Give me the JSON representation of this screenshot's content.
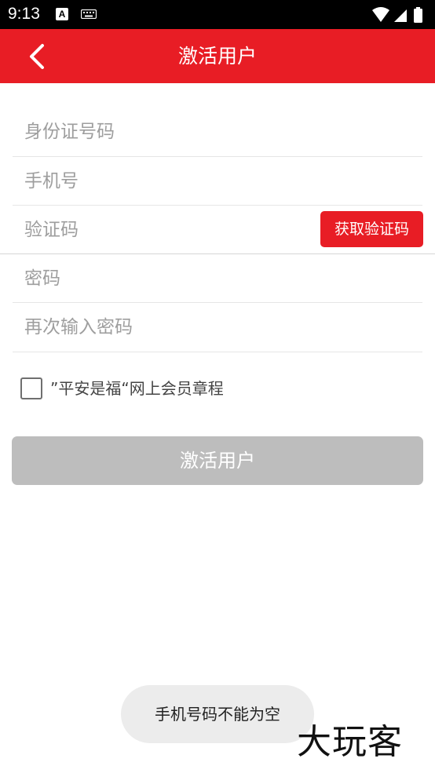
{
  "status_bar": {
    "time": "9:13",
    "notification_letter": "A"
  },
  "app_bar": {
    "title": "激活用户"
  },
  "form": {
    "id_number_placeholder": "身份证号码",
    "phone_placeholder": "手机号",
    "code_placeholder": "验证码",
    "get_code_label": "获取验证码",
    "password_placeholder": "密码",
    "confirm_password_placeholder": "再次输入密码"
  },
  "agreement": {
    "checked": false,
    "label": "”平安是福“网上会员章程"
  },
  "submit": {
    "label": "激活用户",
    "enabled": false
  },
  "toast": {
    "message": "手机号码不能为空"
  },
  "watermark": {
    "text": "大玩客"
  },
  "colors": {
    "primary": "#e81d25",
    "disabled_button": "#bdbdbd",
    "hint_text": "#9e9e9e",
    "toast_bg": "#ececec"
  }
}
